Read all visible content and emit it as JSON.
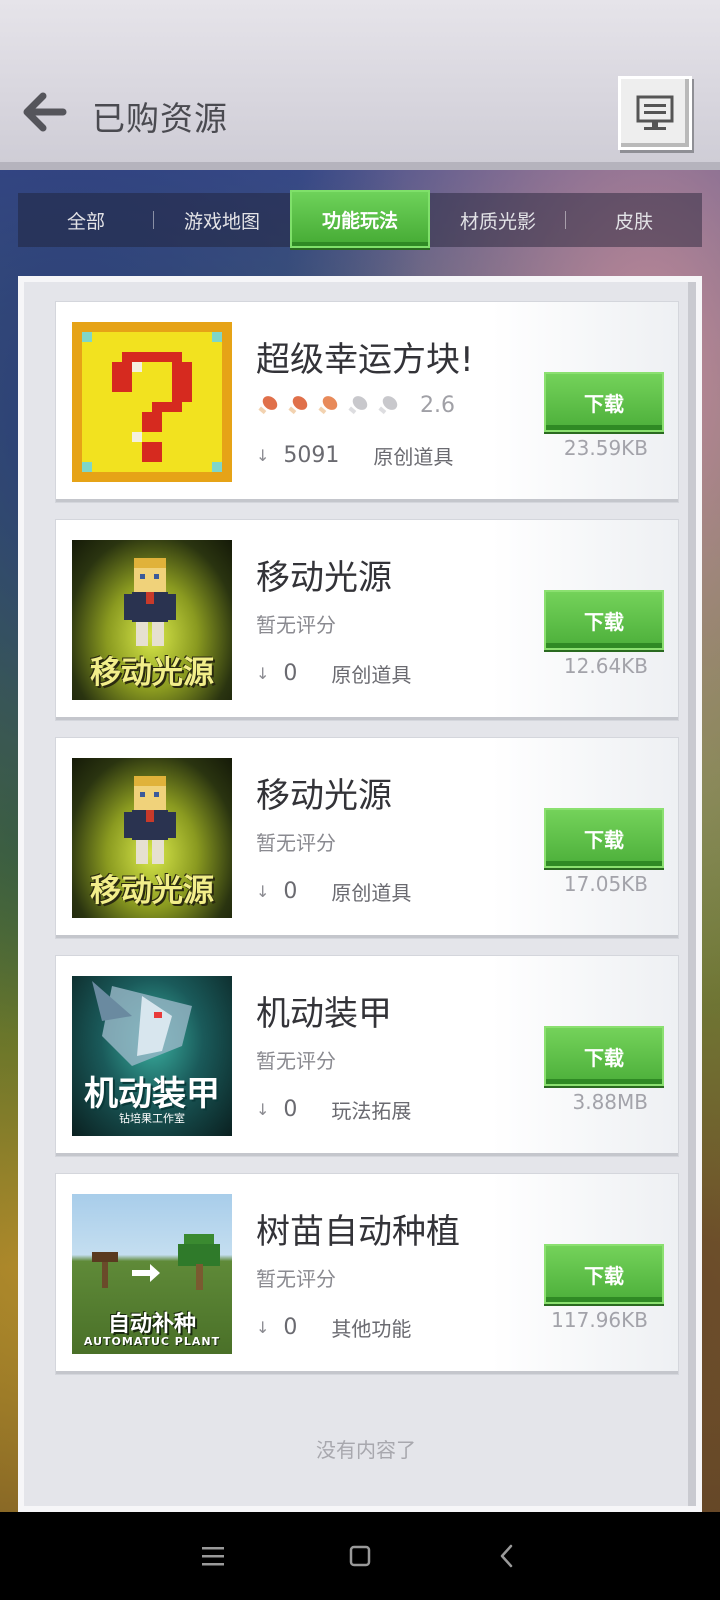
{
  "header": {
    "title": "已购资源"
  },
  "tabs": [
    {
      "label": "全部",
      "active": false
    },
    {
      "label": "游戏地图",
      "active": false
    },
    {
      "label": "功能玩法",
      "active": true
    },
    {
      "label": "材质光影",
      "active": false
    },
    {
      "label": "皮肤",
      "active": false
    }
  ],
  "items": [
    {
      "title": "超级幸运方块!",
      "rating_stars": 2.6,
      "rating_text": "2.6",
      "downloads": "5091",
      "category": "原创道具",
      "button": "下载",
      "size": "23.59KB",
      "thumb_icon": "lucky-block-thumbnail"
    },
    {
      "title": "移动光源",
      "rating_text": "暂无评分",
      "downloads": "0",
      "category": "原创道具",
      "button": "下载",
      "size": "12.64KB",
      "thumb_caption": "移动光源"
    },
    {
      "title": "移动光源",
      "rating_text": "暂无评分",
      "downloads": "0",
      "category": "原创道具",
      "button": "下载",
      "size": "17.05KB",
      "thumb_caption": "移动光源"
    },
    {
      "title": "机动装甲",
      "rating_text": "暂无评分",
      "downloads": "0",
      "category": "玩法拓展",
      "button": "下载",
      "size": "3.88MB",
      "thumb_caption": "机动装甲",
      "thumb_subcaption": "钻培果工作室"
    },
    {
      "title": "树苗自动种植",
      "rating_text": "暂无评分",
      "downloads": "0",
      "category": "其他功能",
      "button": "下载",
      "size": "117.96KB",
      "thumb_caption": "自动补种",
      "thumb_subcaption": "AUTOMATUC PLANT"
    }
  ],
  "footer": {
    "end_text": "没有内容了"
  },
  "colors": {
    "accent_green": "#4caf3a",
    "header_bg": "#d8d6de",
    "panel_bg": "#e4e5ea"
  }
}
